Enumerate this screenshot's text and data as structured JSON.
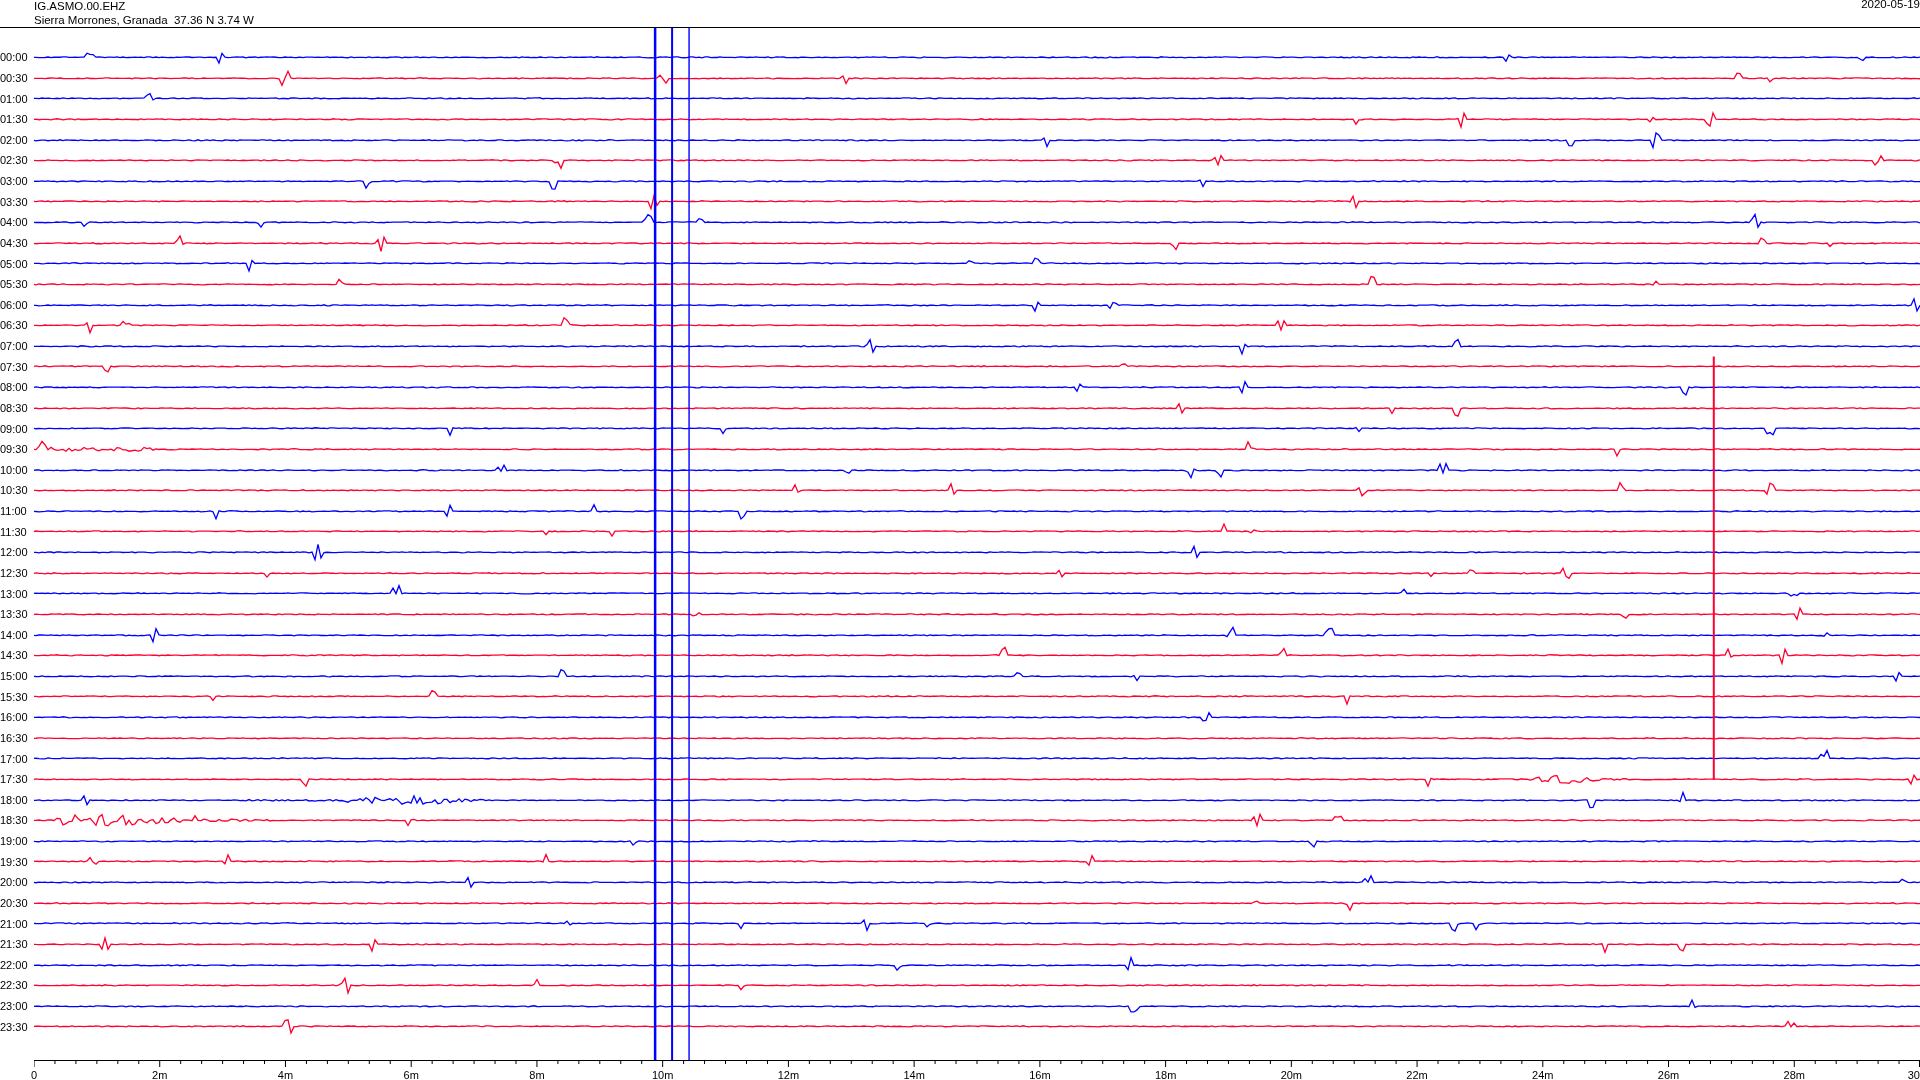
{
  "header": {
    "station": "IG.ASMO.00.EHZ",
    "location": "Sierra Morrones, Granada  37.36 N 3.74 W",
    "date": "2020-05-19"
  },
  "rows": [
    {
      "time": "00:00",
      "color": "#0000ff"
    },
    {
      "time": "00:30",
      "color": "#ff0030"
    },
    {
      "time": "01:00",
      "color": "#0000ff"
    },
    {
      "time": "01:30",
      "color": "#ff0030"
    },
    {
      "time": "02:00",
      "color": "#0000ff"
    },
    {
      "time": "02:30",
      "color": "#ff0030"
    },
    {
      "time": "03:00",
      "color": "#0000ff"
    },
    {
      "time": "03:30",
      "color": "#ff0030"
    },
    {
      "time": "04:00",
      "color": "#0000ff"
    },
    {
      "time": "04:30",
      "color": "#ff0030"
    },
    {
      "time": "05:00",
      "color": "#0000ff"
    },
    {
      "time": "05:30",
      "color": "#ff0030"
    },
    {
      "time": "06:00",
      "color": "#0000ff"
    },
    {
      "time": "06:30",
      "color": "#ff0030"
    },
    {
      "time": "07:00",
      "color": "#0000ff"
    },
    {
      "time": "07:30",
      "color": "#ff0030"
    },
    {
      "time": "08:00",
      "color": "#0000ff"
    },
    {
      "time": "08:30",
      "color": "#ff0030"
    },
    {
      "time": "09:00",
      "color": "#0000ff"
    },
    {
      "time": "09:30",
      "color": "#ff0030"
    },
    {
      "time": "10:00",
      "color": "#0000ff"
    },
    {
      "time": "10:30",
      "color": "#ff0030"
    },
    {
      "time": "11:00",
      "color": "#0000ff"
    },
    {
      "time": "11:30",
      "color": "#ff0030"
    },
    {
      "time": "12:00",
      "color": "#0000ff"
    },
    {
      "time": "12:30",
      "color": "#ff0030"
    },
    {
      "time": "13:00",
      "color": "#0000ff"
    },
    {
      "time": "13:30",
      "color": "#ff0030"
    },
    {
      "time": "14:00",
      "color": "#0000ff"
    },
    {
      "time": "14:30",
      "color": "#ff0030"
    },
    {
      "time": "15:00",
      "color": "#0000ff"
    },
    {
      "time": "15:30",
      "color": "#ff0030"
    },
    {
      "time": "16:00",
      "color": "#0000ff"
    },
    {
      "time": "16:30",
      "color": "#ff0030"
    },
    {
      "time": "17:00",
      "color": "#0000ff"
    },
    {
      "time": "17:30",
      "color": "#ff0030"
    },
    {
      "time": "18:00",
      "color": "#0000ff"
    },
    {
      "time": "18:30",
      "color": "#ff0030"
    },
    {
      "time": "19:00",
      "color": "#0000ff"
    },
    {
      "time": "19:30",
      "color": "#ff0030"
    },
    {
      "time": "20:00",
      "color": "#0000ff"
    },
    {
      "time": "20:30",
      "color": "#ff0030"
    },
    {
      "time": "21:00",
      "color": "#0000ff"
    },
    {
      "time": "21:30",
      "color": "#ff0030"
    },
    {
      "time": "22:00",
      "color": "#0000ff"
    },
    {
      "time": "22:30",
      "color": "#ff0030"
    },
    {
      "time": "23:00",
      "color": "#0000ff"
    },
    {
      "time": "23:30",
      "color": "#ff0030"
    }
  ],
  "x_axis": {
    "labels": [
      "0",
      "2m",
      "4m",
      "6m",
      "8m",
      "10m",
      "12m",
      "14m",
      "16m",
      "18m",
      "20m",
      "22m",
      "24m",
      "26m",
      "28m",
      "30"
    ]
  }
}
